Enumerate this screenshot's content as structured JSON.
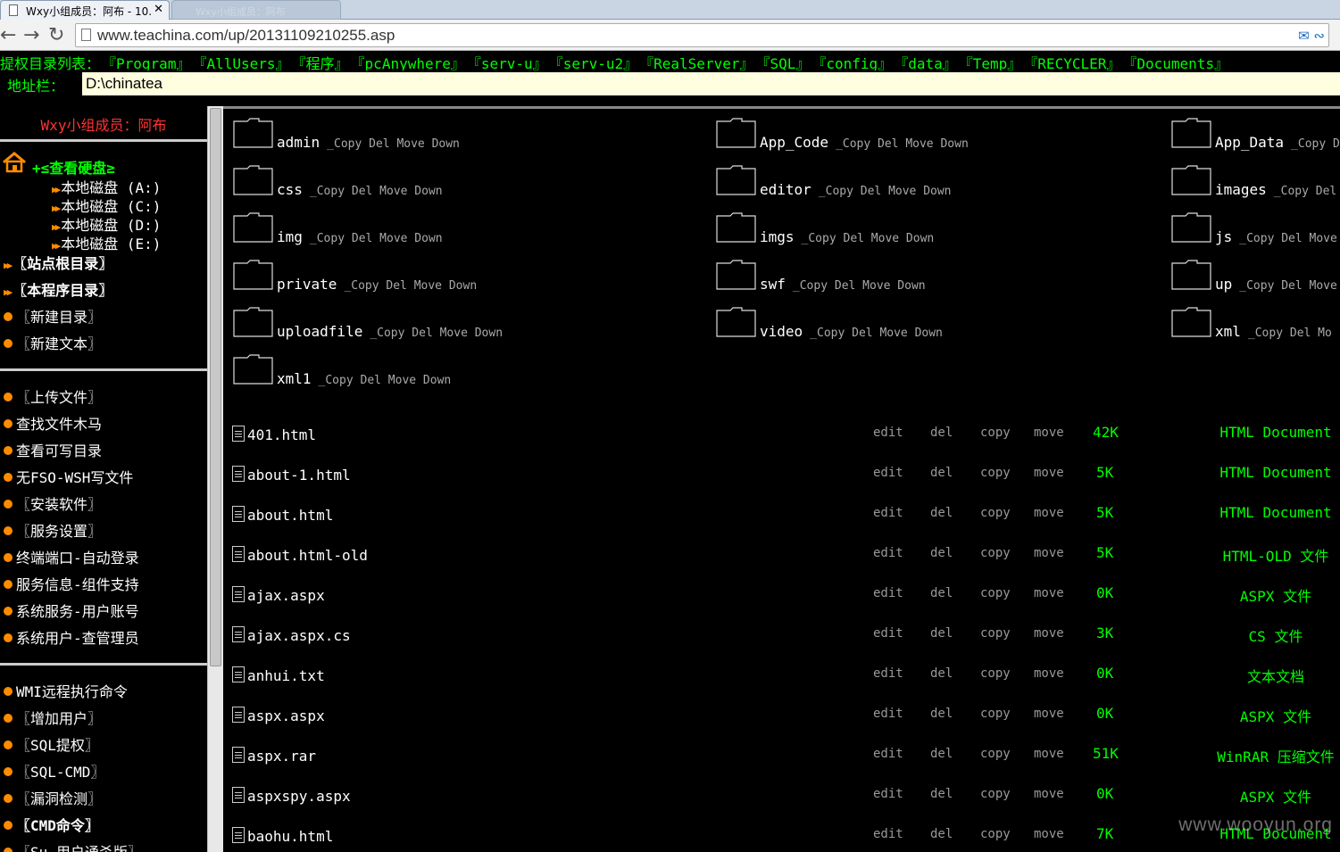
{
  "browser": {
    "tab_title": "Wxy小组成员：阿布 - 10.",
    "tab2_title": "Wxy小组成员：阿布",
    "url": "www.teachina.com/up/20131109210255.asp"
  },
  "priv_bar": {
    "label": "提权目录列表：",
    "items": [
      "『Program』",
      "『AllUsers』",
      "『程序』",
      "『pcAnywhere』",
      "『serv-u』",
      "『serv-u2』",
      "『RealServer』",
      "『SQL』",
      "『config』",
      "『data』",
      "『Temp』",
      "『RECYCLER』",
      "『Documents』"
    ]
  },
  "location": {
    "label": "地址栏：",
    "value": "D:\\chinatea"
  },
  "sidebar": {
    "title": "Wxy小组成员：阿布",
    "drive_header": "+≤查看硬盘≥",
    "drives": [
      "本地磁盘 (A:)",
      "本地磁盘 (C:)",
      "本地磁盘 (D:)",
      "本地磁盘 (E:)"
    ],
    "menu_group1": [
      "〖站点根目录〗",
      "〖本程序目录〗",
      "〖新建目录〗",
      "〖新建文本〗"
    ],
    "menu_group2": [
      "〖上传文件〗",
      "查找文件木马",
      "查看可写目录",
      "无FSO-WSH写文件",
      "〖安装软件〗",
      "〖服务设置〗",
      "终端端口-自动登录",
      "服务信息-组件支持",
      "系统服务-用户账号",
      "系统用户-查管理员"
    ],
    "menu_group3": [
      "WMI远程执行命令",
      "〖增加用户〗",
      "〖SQL提权〗",
      "〖SQL-CMD〗",
      "〖漏洞检测〗",
      "〖CMD命令〗",
      "〖Su-用户通杀版〗"
    ]
  },
  "folders": [
    {
      "name": "admin",
      "ops": "_Copy Del Move Down"
    },
    {
      "name": "App_Code",
      "ops": "_Copy Del Move Down"
    },
    {
      "name": "App_Data",
      "ops": "_Copy D"
    },
    {
      "name": "css",
      "ops": "_Copy Del Move Down"
    },
    {
      "name": "editor",
      "ops": "_Copy Del Move Down"
    },
    {
      "name": "images",
      "ops": "_Copy Del"
    },
    {
      "name": "img",
      "ops": "_Copy Del Move Down"
    },
    {
      "name": "imgs",
      "ops": "_Copy Del Move Down"
    },
    {
      "name": "js",
      "ops": "_Copy Del Move"
    },
    {
      "name": "private",
      "ops": "_Copy Del Move Down"
    },
    {
      "name": "swf",
      "ops": "_Copy Del Move Down"
    },
    {
      "name": "up",
      "ops": "_Copy Del Move"
    },
    {
      "name": "uploadfile",
      "ops": "_Copy Del Move Down"
    },
    {
      "name": "video",
      "ops": "_Copy Del Move Down"
    },
    {
      "name": "xml",
      "ops": "_Copy Del Mo"
    },
    {
      "name": "xml1",
      "ops": "_Copy Del Move Down"
    }
  ],
  "file_ops": {
    "edit": "edit",
    "del": "del",
    "copy": "copy",
    "move": "move"
  },
  "files": [
    {
      "name": "401.html",
      "size": "42K",
      "type": "HTML Document"
    },
    {
      "name": "about-1.html",
      "size": "5K",
      "type": "HTML Document"
    },
    {
      "name": "about.html",
      "size": "5K",
      "type": "HTML Document"
    },
    {
      "name": "about.html-old",
      "size": "5K",
      "type": "HTML-OLD 文件"
    },
    {
      "name": "ajax.aspx",
      "size": "0K",
      "type": "ASPX 文件"
    },
    {
      "name": "ajax.aspx.cs",
      "size": "3K",
      "type": "CS 文件"
    },
    {
      "name": "anhui.txt",
      "size": "0K",
      "type": "文本文档"
    },
    {
      "name": "aspx.aspx",
      "size": "0K",
      "type": "ASPX 文件"
    },
    {
      "name": "aspx.rar",
      "size": "51K",
      "type": "WinRAR 压缩文件"
    },
    {
      "name": "aspxspy.aspx",
      "size": "0K",
      "type": "ASPX 文件"
    },
    {
      "name": "baohu.html",
      "size": "7K",
      "type": "HTML Document"
    }
  ],
  "watermark": "www.wooyun.org"
}
